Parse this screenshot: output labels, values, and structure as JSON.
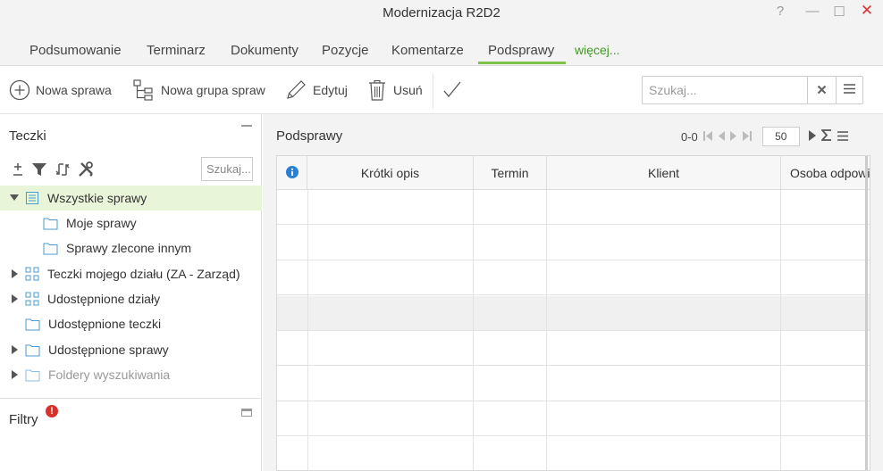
{
  "window": {
    "title": "Modernizacja R2D2",
    "help_label": "?",
    "minimize_label": "—",
    "maximize_label": "☐",
    "close_label": "✕"
  },
  "tabs": [
    {
      "label": "Podsumowanie",
      "active": false
    },
    {
      "label": "Terminarz",
      "active": false
    },
    {
      "label": "Dokumenty",
      "active": false
    },
    {
      "label": "Pozycje",
      "active": false
    },
    {
      "label": "Komentarze",
      "active": false
    },
    {
      "label": "Podsprawy",
      "active": true
    }
  ],
  "more_tabs_label": "więcej...",
  "toolbar": {
    "new_case_label": "Nowa sprawa",
    "new_group_label": "Nowa grupa spraw",
    "edit_label": "Edytuj",
    "delete_label": "Usuń",
    "search_placeholder": "Szukaj...",
    "search_value": ""
  },
  "folders_panel": {
    "title": "Teczki",
    "search_placeholder": "Szukaj...",
    "tree": [
      {
        "label": "Wszystkie sprawy",
        "icon": "list-folder-icon",
        "expanded": true,
        "selected": true,
        "disabled": false
      },
      {
        "label": "Moje sprawy",
        "icon": "folder-icon",
        "child": true,
        "disabled": false
      },
      {
        "label": "Sprawy zlecone innym",
        "icon": "folder-icon",
        "child": true,
        "disabled": false
      },
      {
        "label": "Teczki mojego działu (ZA - Zarząd)",
        "icon": "department-icon",
        "expandable": true,
        "disabled": false
      },
      {
        "label": "Udostępnione działy",
        "icon": "department-icon",
        "expandable": true,
        "disabled": false
      },
      {
        "label": "Udostępnione teczki",
        "icon": "folder-icon",
        "expandable": false,
        "disabled": false
      },
      {
        "label": "Udostępnione sprawy",
        "icon": "folder-icon",
        "expandable": true,
        "disabled": false
      },
      {
        "label": "Foldery wyszukiwania",
        "icon": "folder-icon",
        "expandable": true,
        "disabled": true
      }
    ]
  },
  "filters_panel": {
    "title": "Filtry",
    "badge": "!"
  },
  "grid": {
    "title": "Podsprawy",
    "range": "0-0",
    "page_size": "50",
    "columns": [
      "Krótki opis",
      "Termin",
      "Klient",
      "Osoba odpowiedzialna"
    ],
    "rows": []
  },
  "colors": {
    "accent_green": "#7fc24a",
    "more_link": "#3e9b1f",
    "selected_row": "#e8f5d9",
    "info_blue": "#2a7fd4",
    "alert_red": "#d9302a"
  }
}
